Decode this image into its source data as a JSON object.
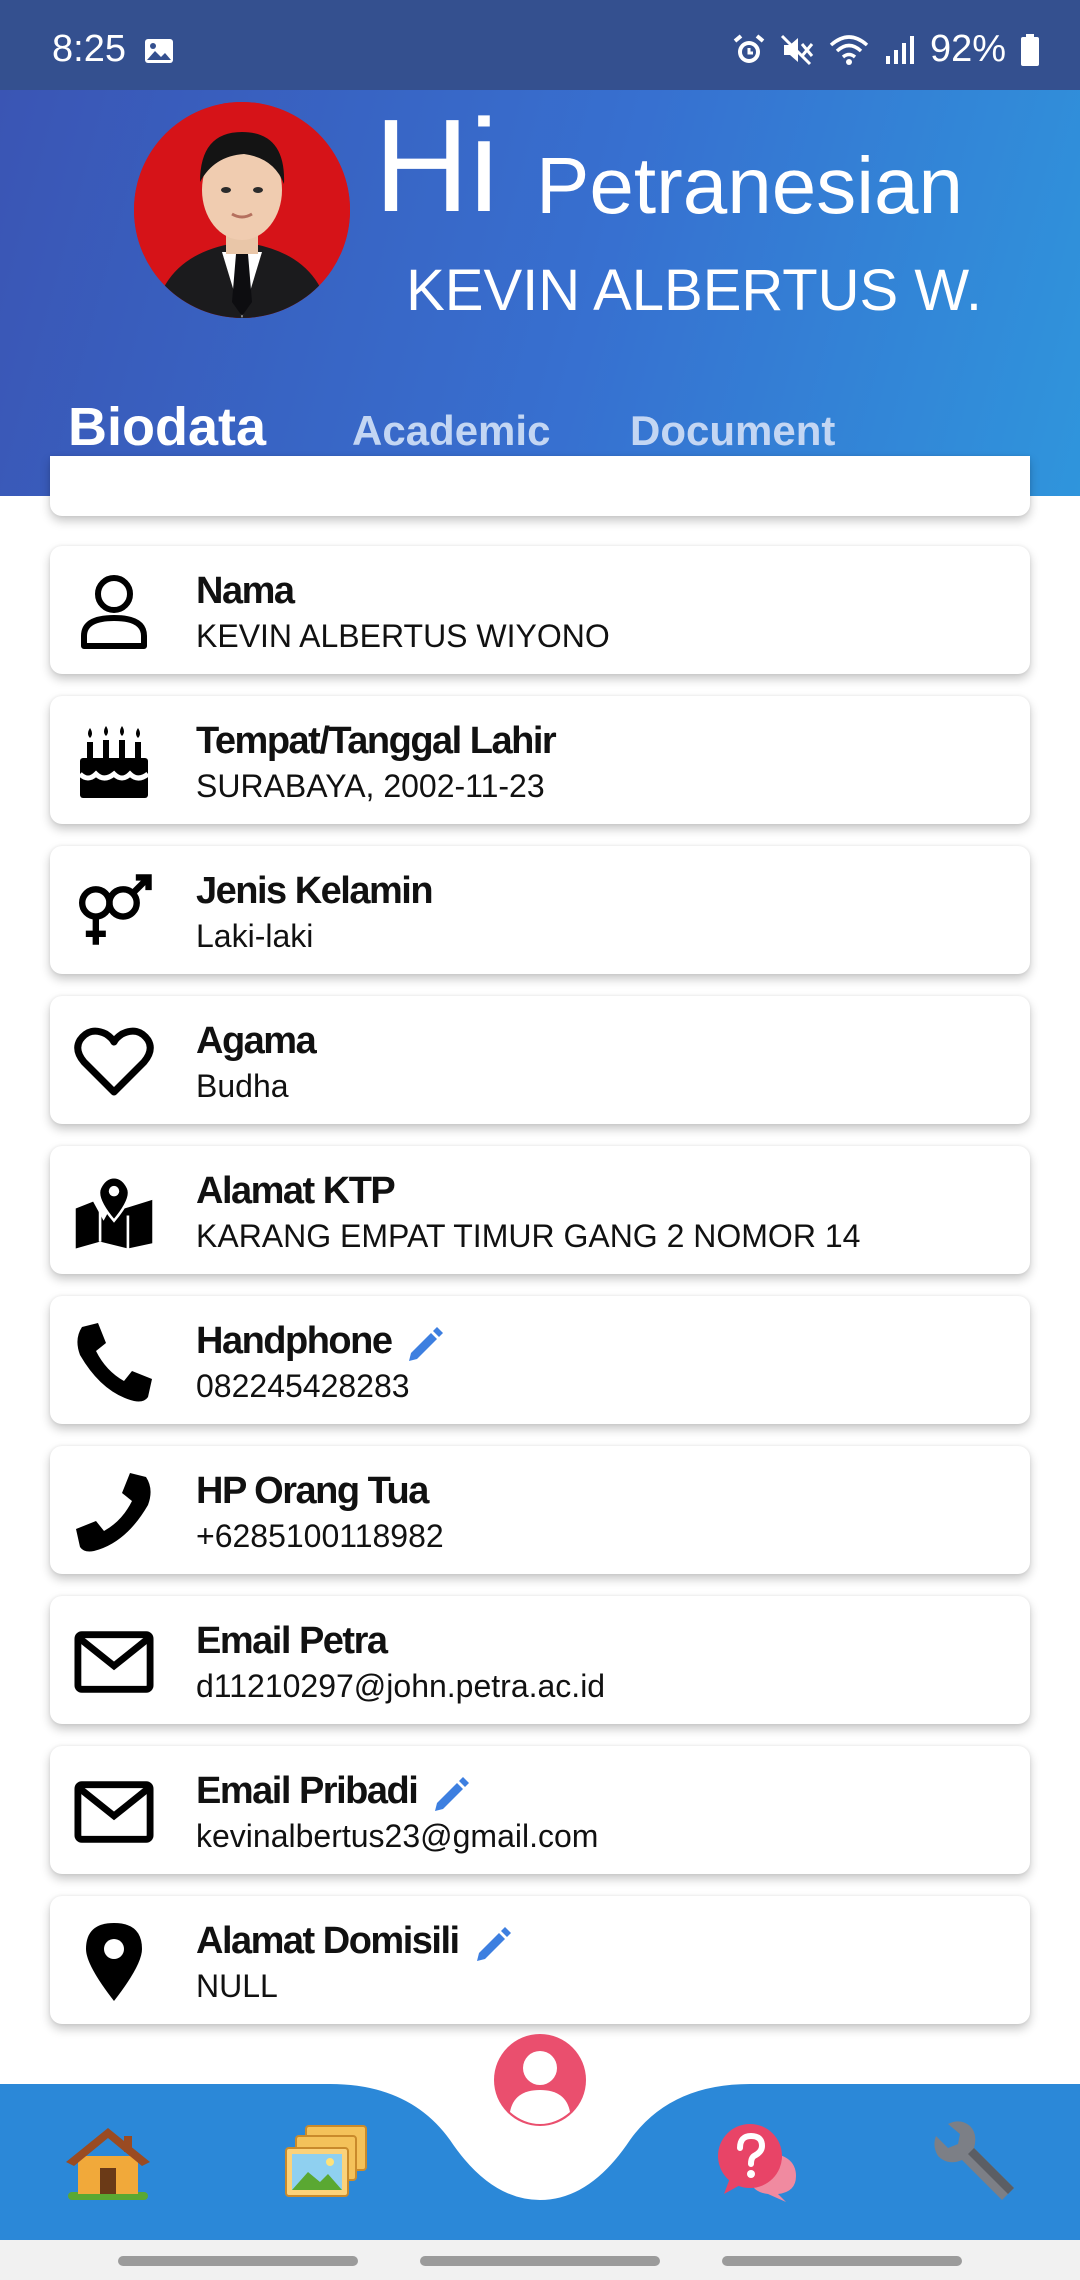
{
  "status_bar": {
    "time": "8:25",
    "battery": "92%",
    "icons": [
      "image-icon",
      "alarm-icon",
      "mute-icon",
      "wifi-icon",
      "signal-icon",
      "battery-icon"
    ]
  },
  "header": {
    "greeting_hi": "Hi",
    "greeting_sub": "Petranesian",
    "user_name": "KEVIN ALBERTUS W.",
    "avatar": "profile-photo",
    "colors": {
      "gradient_start": "#3a55b4",
      "gradient_end": "#2f95dc",
      "avatar_bg": "#d61318"
    }
  },
  "tabs": [
    {
      "label": "Biodata",
      "active": true
    },
    {
      "label": "Academic",
      "active": false
    },
    {
      "label": "Document",
      "active": false
    }
  ],
  "biodata": [
    {
      "icon": "person-icon",
      "title": "Nama",
      "value": "KEVIN ALBERTUS WIYONO",
      "editable": false
    },
    {
      "icon": "birthday-cake-icon",
      "title": "Tempat/Tanggal Lahir",
      "value": "SURABAYA, 2002-11-23",
      "editable": false
    },
    {
      "icon": "gender-icon",
      "title": "Jenis Kelamin",
      "value": "Laki-laki",
      "editable": false
    },
    {
      "icon": "heart-icon",
      "title": "Agama",
      "value": "Budha",
      "editable": false
    },
    {
      "icon": "map-icon",
      "title": "Alamat KTP",
      "value": "KARANG EMPAT TIMUR GANG 2 NOMOR 14",
      "editable": false
    },
    {
      "icon": "phone-icon",
      "title": "Handphone",
      "value": "082245428283",
      "editable": true
    },
    {
      "icon": "phone-icon",
      "title": "HP Orang Tua",
      "value": "+6285100118982",
      "editable": false
    },
    {
      "icon": "envelope-icon",
      "title": "Email Petra",
      "value": "d11210297@john.petra.ac.id",
      "editable": false
    },
    {
      "icon": "envelope-icon",
      "title": "Email Pribadi",
      "value": "kevinalbertus23@gmail.com",
      "editable": true
    },
    {
      "icon": "location-pin-icon",
      "title": "Alamat Domisili",
      "value": "NULL",
      "editable": true
    }
  ],
  "bottom_nav": {
    "items": [
      "home-icon",
      "gallery-icon",
      "profile-icon",
      "help-icon",
      "wrench-icon"
    ],
    "active": "profile-icon",
    "colors": {
      "bar": "#2b88d8",
      "active": "#ea4f6e",
      "edit": "#3d7fe0"
    }
  }
}
